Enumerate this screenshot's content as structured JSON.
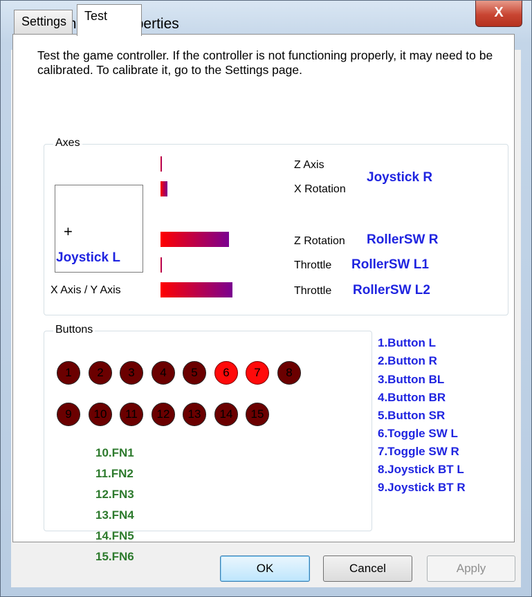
{
  "window": {
    "title": "GamePad properties",
    "close": "X"
  },
  "tabs": [
    {
      "label": "Settings"
    },
    {
      "label": "Test"
    }
  ],
  "description": "Test the game controller.  If the controller is not functioning properly, it may need to be calibrated.  To calibrate it, go to the Settings page.",
  "axes": {
    "group_label": "Axes",
    "xy_caption": "X Axis / Y Axis",
    "cross_symbol": "+",
    "joystick_left_label": "Joystick L",
    "rows": [
      {
        "axis": "Z Axis",
        "level": 0.01
      },
      {
        "axis": "X Rotation",
        "level": 0.1
      },
      {
        "axis": "Z Rotation",
        "level": 0.95
      },
      {
        "axis": "Throttle",
        "level": 0.01
      },
      {
        "axis": "Throttle",
        "level": 1.0
      }
    ],
    "mappings": [
      "Joystick R",
      "RollerSW R",
      "RollerSW L1",
      "RollerSW L2"
    ]
  },
  "buttons": {
    "group_label": "Buttons",
    "indicators": [
      {
        "number": "1",
        "pressed": false
      },
      {
        "number": "2",
        "pressed": false
      },
      {
        "number": "3",
        "pressed": false
      },
      {
        "number": "4",
        "pressed": false
      },
      {
        "number": "5",
        "pressed": false
      },
      {
        "number": "6",
        "pressed": true
      },
      {
        "number": "7",
        "pressed": true
      },
      {
        "number": "8",
        "pressed": false
      },
      {
        "number": "9",
        "pressed": false
      },
      {
        "number": "10",
        "pressed": false
      },
      {
        "number": "11",
        "pressed": false
      },
      {
        "number": "12",
        "pressed": false
      },
      {
        "number": "13",
        "pressed": false
      },
      {
        "number": "14",
        "pressed": false
      },
      {
        "number": "15",
        "pressed": false
      }
    ],
    "legend": [
      "1.Button L",
      "2.Button R",
      "3.Button BL",
      "4.Button BR",
      "5.Button SR",
      "6.Toggle SW L",
      "7.Toggle SW R",
      "8.Joystick BT L",
      "9.Joystick BT R"
    ],
    "fn_legend": [
      "10.FN1",
      "11.FN2",
      "12.FN3",
      "13.FN4",
      "14.FN5",
      "15.FN6"
    ]
  },
  "dialog_buttons": {
    "ok": "OK",
    "cancel": "Cancel",
    "apply": "Apply"
  },
  "colors": {
    "mapping_blue": "#1f24e0",
    "fn_green": "#2d7a2d",
    "pressed_red": "#ff0a0a",
    "released_dark_red": "#6b0000",
    "bar_gradient_start": "#ff0000",
    "bar_gradient_end": "#7a0090"
  },
  "icons": {
    "title": "gamepad-icon"
  }
}
